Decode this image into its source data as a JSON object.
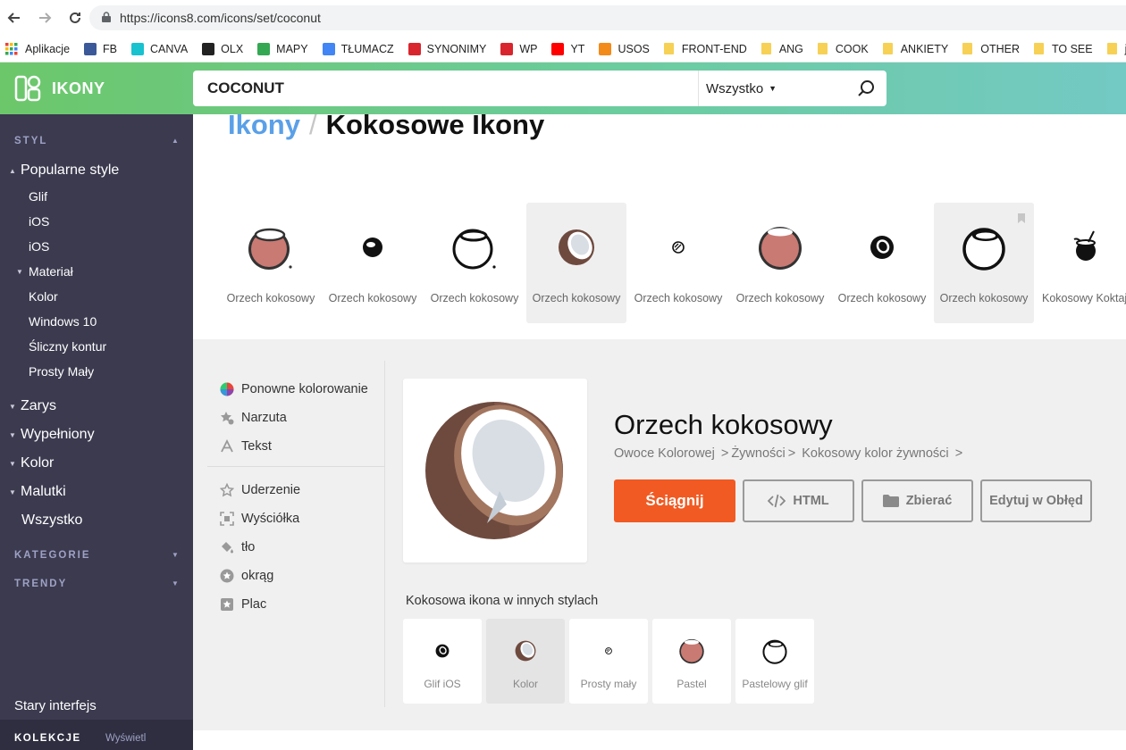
{
  "browser": {
    "url": "https://icons8.com/icons/set/coconut",
    "bookmarks": [
      {
        "label": "Aplikacje",
        "color": "#e04a3b"
      },
      {
        "label": "FB",
        "color": "#3b5998"
      },
      {
        "label": "CANVA",
        "color": "#18c2cf"
      },
      {
        "label": "OLX",
        "color": "#222222"
      },
      {
        "label": "MAPY",
        "color": "#34a853"
      },
      {
        "label": "TŁUMACZ",
        "color": "#4285f4"
      },
      {
        "label": "SYNONIMY",
        "color": "#d9252e"
      },
      {
        "label": "WP",
        "color": "#d9252e"
      },
      {
        "label": "YT",
        "color": "#ff0000"
      },
      {
        "label": "USOS",
        "color": "#f28b1a"
      }
    ],
    "folders": [
      "FRONT-END",
      "ANG",
      "COOK",
      "ANKIETY",
      "OTHER",
      "TO SEE",
      "jed"
    ]
  },
  "header": {
    "logo_text": "IKONY",
    "search_value": "COCONUT",
    "filter_value": "Wszystko"
  },
  "sidebar": {
    "style_title": "STYL",
    "popular_label": "Popularne style",
    "popular_items": [
      "Glif",
      "iOS",
      "iOS"
    ],
    "material_label": "Materiał",
    "material_items": [
      "Kolor",
      "Windows 10",
      "Śliczny kontur",
      "Prosty Mały"
    ],
    "groups": [
      "Zarys",
      "Wypełniony",
      "Kolor",
      "Malutki"
    ],
    "all_label": "Wszystko",
    "categories_title": "KATEGORIE",
    "trends_title": "TRENDY",
    "old_interface": "Stary interfejs",
    "collections_title": "KOLEKCJE",
    "collections_action": "Wyświetl"
  },
  "main": {
    "breadcrumb_root": "Ikony",
    "breadcrumb_sep": "/",
    "breadcrumb_current": "Kokosowe Ikony",
    "strip": [
      {
        "label": "Orzech kokosowy",
        "style": "pastel"
      },
      {
        "label": "Orzech kokosowy",
        "style": "glyph-small"
      },
      {
        "label": "Orzech kokosowy",
        "style": "outline"
      },
      {
        "label": "Orzech kokosowy",
        "style": "color"
      },
      {
        "label": "Orzech kokosowy",
        "style": "tiny"
      },
      {
        "label": "Orzech kokosowy",
        "style": "pastel-big"
      },
      {
        "label": "Orzech kokosowy",
        "style": "glyph"
      },
      {
        "label": "Orzech kokosowy",
        "style": "outline-bold"
      },
      {
        "label": "Kokosowy Koktajl",
        "style": "cocktail"
      }
    ]
  },
  "detail": {
    "options": [
      {
        "label": "Ponowne kolorowanie",
        "icon": "color-wheel-icon"
      },
      {
        "label": "Narzuta",
        "icon": "star-badge-icon"
      },
      {
        "label": "Tekst",
        "icon": "text-icon"
      },
      {
        "label": "Uderzenie",
        "icon": "star-outline-icon"
      },
      {
        "label": "Wyściółka",
        "icon": "padding-icon"
      },
      {
        "label": "tło",
        "icon": "paint-bucket-icon"
      },
      {
        "label": "okrąg",
        "icon": "star-circle-icon"
      },
      {
        "label": "Plac",
        "icon": "star-square-icon"
      }
    ],
    "title": "Orzech kokosowy",
    "path": [
      "Owoce Kolorowej",
      "Żywności",
      "Kokosowy kolor żywności"
    ],
    "download_label": "Ściągnij",
    "html_label": "HTML",
    "collect_label": "Zbierać",
    "edit_label": "Edytuj w Obłęd",
    "accent_color": "#f15a22",
    "other_styles_title": "Kokosowa ikona w innych stylach",
    "other_styles": [
      "Glif iOS",
      "Kolor",
      "Prosty mały",
      "Pastel",
      "Pastelowy glif"
    ]
  }
}
